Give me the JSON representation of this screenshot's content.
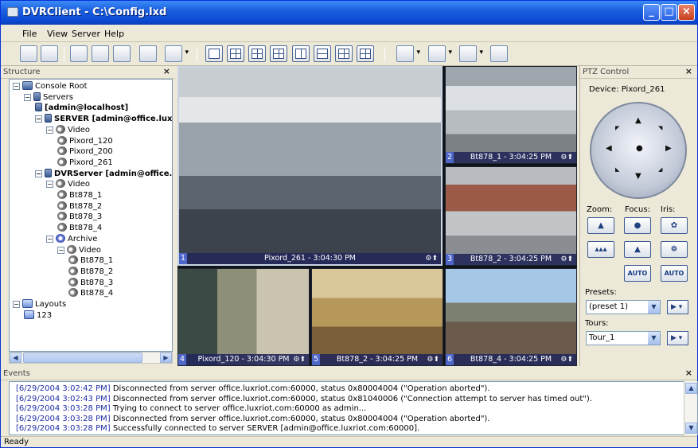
{
  "window": {
    "title": "DVRClient - C:\\Config.lxd"
  },
  "menu": [
    "File",
    "View",
    "Server",
    "Help"
  ],
  "structure_panel": {
    "title": "Structure",
    "tree": [
      {
        "label": "Console Root",
        "level": 0,
        "icon": "computer-icon"
      },
      {
        "label": "Servers",
        "level": 1,
        "icon": "servers-icon"
      },
      {
        "label": "[admin@localhost]",
        "level": 2,
        "icon": "server-icon",
        "bold": true
      },
      {
        "label": "SERVER [admin@office.luxriot.c",
        "level": 2,
        "icon": "server-icon",
        "bold": true
      },
      {
        "label": "Video",
        "level": 3,
        "icon": "camera-icon"
      },
      {
        "label": "Pixord_120",
        "level": 4,
        "icon": "camera-icon"
      },
      {
        "label": "Pixord_200",
        "level": 4,
        "icon": "camera-icon"
      },
      {
        "label": "Pixord_261",
        "level": 4,
        "icon": "camera-icon"
      },
      {
        "label": "DVRServer [admin@office.luxr",
        "level": 2,
        "icon": "server-icon",
        "bold": true
      },
      {
        "label": "Video",
        "level": 3,
        "icon": "camera-icon"
      },
      {
        "label": "Bt878_1",
        "level": 4,
        "icon": "camera-icon"
      },
      {
        "label": "Bt878_2",
        "level": 4,
        "icon": "camera-icon"
      },
      {
        "label": "Bt878_3",
        "level": 4,
        "icon": "camera-icon"
      },
      {
        "label": "Bt878_4",
        "level": 4,
        "icon": "camera-icon"
      },
      {
        "label": "Archive",
        "level": 3,
        "icon": "archive-icon"
      },
      {
        "label": "Video",
        "level": 4,
        "icon": "camera-icon"
      },
      {
        "label": "Bt878_1",
        "level": 5,
        "icon": "camera-icon"
      },
      {
        "label": "Bt878_2",
        "level": 5,
        "icon": "camera-icon"
      },
      {
        "label": "Bt878_3",
        "level": 5,
        "icon": "camera-icon"
      },
      {
        "label": "Bt878_4",
        "level": 5,
        "icon": "camera-icon"
      },
      {
        "label": "Layouts",
        "level": 0,
        "icon": "layouts-icon"
      },
      {
        "label": "123",
        "level": 1,
        "icon": "layout-icon"
      }
    ]
  },
  "tiles": [
    {
      "num": "1",
      "label": "Pixord_261 - 3:04:30 PM"
    },
    {
      "num": "2",
      "label": "Bt878_1 - 3:04:25 PM"
    },
    {
      "num": "3",
      "label": "Bt878_2 - 3:04:25 PM"
    },
    {
      "num": "4",
      "label": "Pixord_120 - 3:04:30 PM"
    },
    {
      "num": "5",
      "label": "Bt878_2 - 3:04:25 PM"
    },
    {
      "num": "6",
      "label": "Bt878_4 - 3:04:25 PM"
    }
  ],
  "ptz": {
    "title": "PTZ Control",
    "device": "Device: Pixord_261",
    "zoom_label": "Zoom:",
    "focus_label": "Focus:",
    "iris_label": "Iris:",
    "auto_focus": "AUTO",
    "auto_iris": "AUTO",
    "presets_label": "Presets:",
    "preset_value": "(preset 1)",
    "tours_label": "Tours:",
    "tour_value": "Tour_1"
  },
  "events": {
    "title": "Events",
    "lines": [
      {
        "ts": "[6/29/2004 3:02:42 PM]",
        "msg": " Disconnected from server office.luxriot.com:60000, status 0x80004004 (\"Operation aborted\")."
      },
      {
        "ts": "[6/29/2004 3:02:43 PM]",
        "msg": " Disconnected from server office.luxriot.com:60000, status 0x81040006 (\"Connection attempt to server has timed out\")."
      },
      {
        "ts": "[6/29/2004 3:03:28 PM]",
        "msg": " Trying to connect to server office.luxriot.com:60000 as admin..."
      },
      {
        "ts": "[6/29/2004 3:03:28 PM]",
        "msg": " Disconnected from server office.luxriot.com:60000, status 0x80004004 (\"Operation aborted\")."
      },
      {
        "ts": "[6/29/2004 3:03:28 PM]",
        "msg": " Successfully connected to server SERVER [admin@office.luxriot.com:60000]."
      }
    ]
  },
  "status": "Ready"
}
